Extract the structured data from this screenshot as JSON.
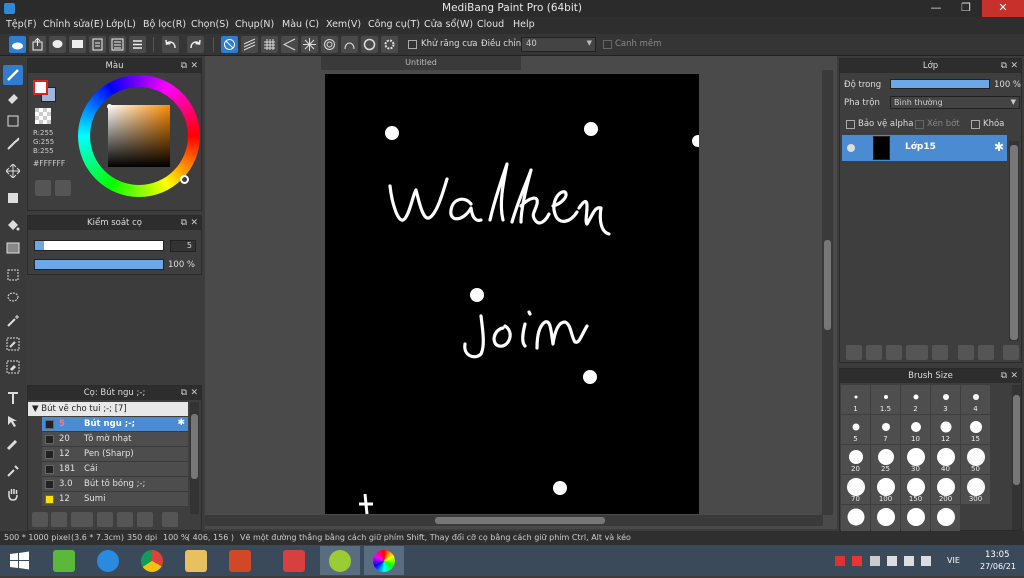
{
  "window": {
    "title": "MediBang Paint Pro (64bit)",
    "minimize": "—",
    "maximize": "❐",
    "close": "✕"
  },
  "menu": [
    "Tệp(F)",
    "Chỉnh sửa(E)",
    "Lớp(L)",
    "Bộ lọc(R)",
    "Chọn(S)",
    "Chụp(N)",
    "Màu (C)",
    "Xem(V)",
    "Công cụ(T)",
    "Cửa sổ(W)",
    "Cloud",
    "Help"
  ],
  "toolbar": {
    "antialias_label": "Khử răng cưa",
    "adjust_label": "Điều chỉnh",
    "adjust_value": "40",
    "smooth_label": "Canh mềm"
  },
  "color_panel": {
    "title": "Màu",
    "r": "R:255",
    "g": "G:255",
    "b": "B:255",
    "hex": "#FFFFFF",
    "fg_color": "#ffffff",
    "bg_color": "#9fb7dc"
  },
  "brush_control": {
    "title": "Kiểm soát cọ",
    "size_value": "5",
    "opacity_value": "100 %",
    "size_fraction": 0.07,
    "opacity_fraction": 1.0
  },
  "brush_panel": {
    "title": "Cọ: Bút ngu ;-;",
    "group": "Bút vẽ cho tui ;-; [7]",
    "rows": [
      {
        "size": "5",
        "name": "Bút ngu ;-;",
        "selected": true,
        "swatch": "#222222"
      },
      {
        "size": "20",
        "name": "Tô mờ nhạt",
        "selected": false,
        "swatch": "#222222"
      },
      {
        "size": "12",
        "name": "Pen (Sharp)",
        "selected": false,
        "swatch": "#222222"
      },
      {
        "size": "181",
        "name": "Cái",
        "selected": false,
        "swatch": "#222222"
      },
      {
        "size": "3.0",
        "name": "Bút tô bóng ;-;",
        "selected": false,
        "swatch": "#222222"
      },
      {
        "size": "12",
        "name": "Sumi",
        "selected": false,
        "swatch": "#ffe000"
      }
    ]
  },
  "canvas": {
    "tab_title": "Untitled",
    "lettering": [
      "walker",
      "join"
    ]
  },
  "layer_panel": {
    "title": "Lớp",
    "opacity_label": "Độ trong",
    "opacity_value": "100 %",
    "blend_label": "Pha trộn",
    "blend_value": "Bình thường",
    "protect_alpha": "Bảo vệ alpha",
    "clipping": "Xén bớt",
    "lock": "Khóa",
    "layer_name": "Lớp15"
  },
  "brush_size_panel": {
    "title": "Brush Size",
    "sizes": [
      "1",
      "1.5",
      "2",
      "3",
      "4",
      "5",
      "7",
      "10",
      "12",
      "15",
      "20",
      "25",
      "30",
      "40",
      "50",
      "70",
      "100",
      "150",
      "200",
      "300"
    ]
  },
  "status": {
    "dimensions": "500 * 1000 pixel",
    "physical": "(3.6 * 7.3cm)",
    "dpi": "350 dpi",
    "zoom": "100 %",
    "coords": "( 406, 156 )",
    "hint": "Vẽ một đường thẳng bằng cách giữ phím Shift, Thay đổi cỡ cọ bằng cách giữ phím Ctrl, Alt và kéo"
  },
  "taskbar": {
    "lang": "VIE",
    "time": "13:05",
    "date": "27/06/21"
  }
}
